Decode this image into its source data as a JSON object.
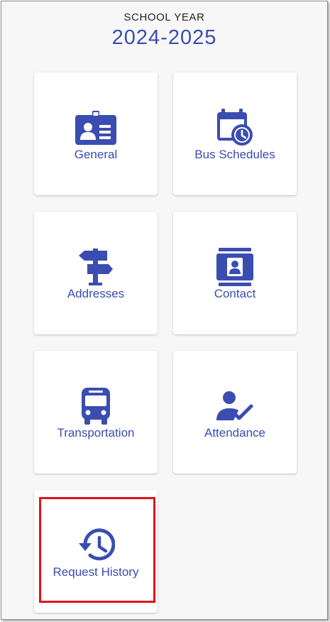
{
  "header": {
    "label": "SCHOOL YEAR",
    "year": "2024-2025"
  },
  "tiles": [
    {
      "label": "General",
      "icon": "id-badge-icon"
    },
    {
      "label": "Bus Schedules",
      "icon": "calendar-clock-icon"
    },
    {
      "label": "Addresses",
      "icon": "signpost-icon"
    },
    {
      "label": "Contact",
      "icon": "contact-book-icon"
    },
    {
      "label": "Transportation",
      "icon": "bus-icon"
    },
    {
      "label": "Attendance",
      "icon": "person-check-icon"
    },
    {
      "label": "Request History",
      "icon": "history-icon"
    }
  ],
  "colors": {
    "accent": "#3a4db0",
    "highlight": "#e0121b",
    "background": "#f7f7f7"
  }
}
